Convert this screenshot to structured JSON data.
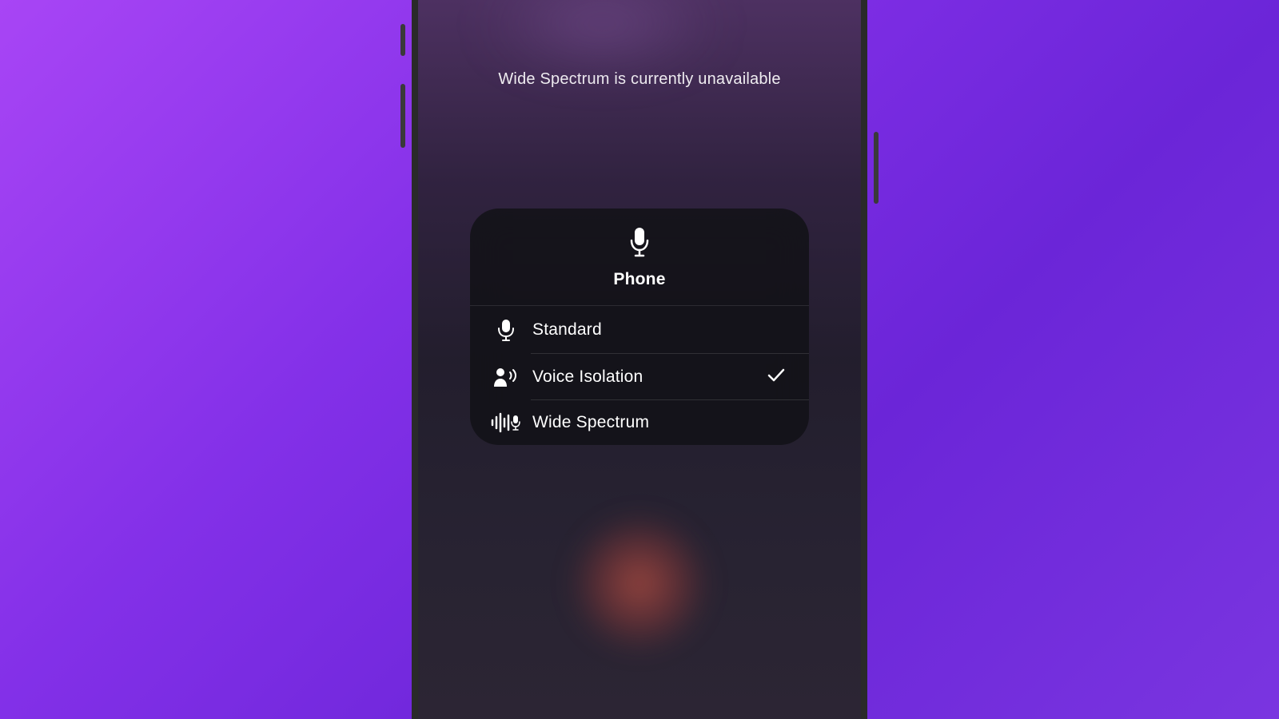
{
  "status": {
    "message": "Wide Spectrum is currently unavailable"
  },
  "menu": {
    "header": {
      "title": "Phone",
      "icon": "microphone-icon"
    },
    "options": [
      {
        "label": "Standard",
        "icon": "microphone-icon",
        "selected": false
      },
      {
        "label": "Voice Isolation",
        "icon": "person-speaking-icon",
        "selected": true
      },
      {
        "label": "Wide Spectrum",
        "icon": "waveform-mic-icon",
        "selected": false
      }
    ]
  }
}
